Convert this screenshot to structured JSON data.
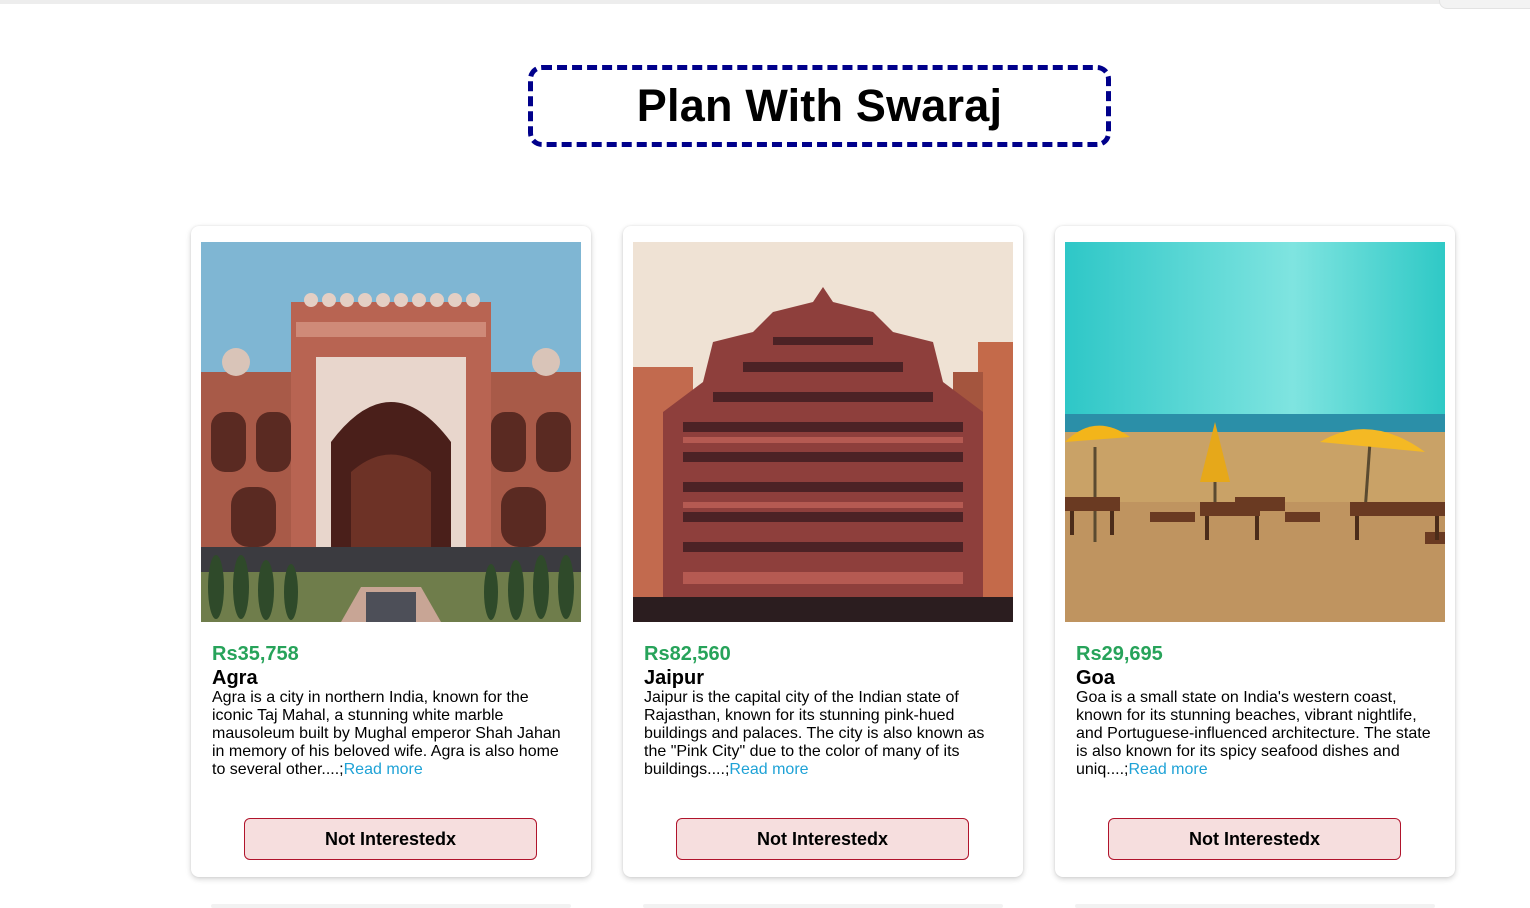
{
  "header": {
    "title": "Plan With Swaraj"
  },
  "tours": [
    {
      "price": "Rs35,758",
      "name": "Agra",
      "description": "Agra is a city in northern India, known for the iconic Taj Mahal, a stunning white marble mausoleum built by Mughal emperor Shah Jahan in memory of his beloved wife. Agra is also home to several other....;",
      "read_more": "Read more",
      "button_label": "Not Interestedx",
      "image_icon": "red-fort-gate-photo"
    },
    {
      "price": "Rs82,560",
      "name": "Jaipur",
      "description": "Jaipur is the capital city of the Indian state of Rajasthan, known for its stunning pink-hued buildings and palaces. The city is also known as the \"Pink City\" due to the color of many of its buildings....;",
      "read_more": "Read more",
      "button_label": "Not Interestedx",
      "image_icon": "hawa-mahal-photo"
    },
    {
      "price": "Rs29,695",
      "name": "Goa",
      "description": "Goa is a small state on India's western coast, known for its stunning beaches, vibrant nightlife, and Portuguese-influenced architecture. The state is also known for its spicy seafood dishes and uniq....;",
      "read_more": "Read more",
      "button_label": "Not Interestedx",
      "image_icon": "beach-umbrella-photo"
    }
  ],
  "colors": {
    "title_border": "#00008b",
    "price": "#27a35a",
    "link": "#1ea2d6",
    "button_bg": "#f6dede",
    "button_border": "#b0142c"
  }
}
